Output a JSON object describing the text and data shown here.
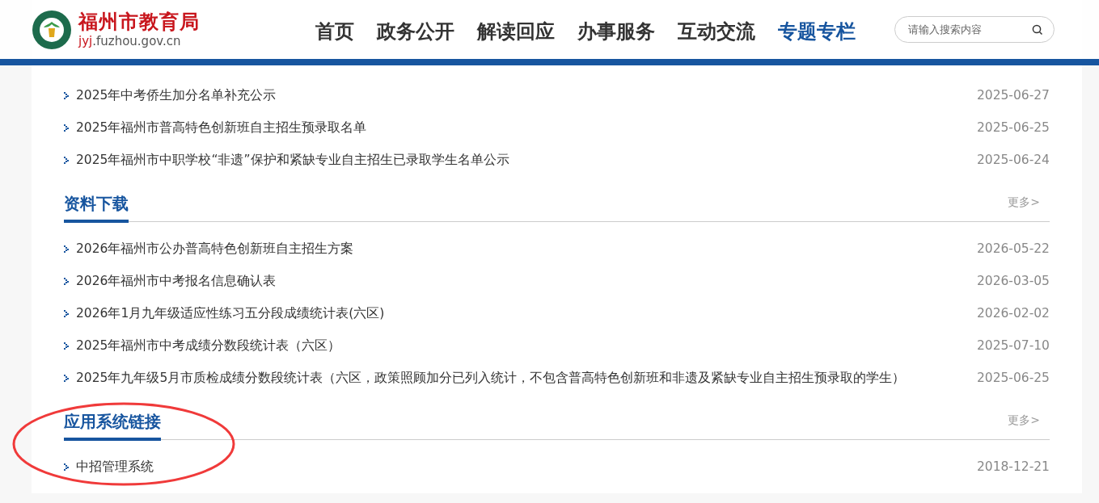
{
  "header": {
    "site_name": "福州市教育局",
    "site_url": {
      "highlight": "jyj",
      "rest": ".fuzhou.gov.cn"
    },
    "nav": [
      {
        "label": "首页",
        "selected": false
      },
      {
        "label": "政务公开",
        "selected": false
      },
      {
        "label": "解读回应",
        "selected": false
      },
      {
        "label": "办事服务",
        "selected": false
      },
      {
        "label": "互动交流",
        "selected": false
      },
      {
        "label": "专题专栏",
        "selected": true
      }
    ],
    "search": {
      "placeholder": "请输入搜索内容"
    }
  },
  "sections": [
    {
      "items": [
        {
          "title": "2025年中考侨生加分名单补充公示",
          "date": "2025-06-27"
        },
        {
          "title": "2025年福州市普高特色创新班自主招生预录取名单",
          "date": "2025-06-25"
        },
        {
          "title": "2025年福州市中职学校“非遗”保护和紧缺专业自主招生已录取学生名单公示",
          "date": "2025-06-24"
        }
      ]
    },
    {
      "title": "资料下载",
      "more": "更多>",
      "items": [
        {
          "title": "2026年福州市公办普高特色创新班自主招生方案",
          "date": "2026-05-22"
        },
        {
          "title": "2026年福州市中考报名信息确认表",
          "date": "2026-03-05"
        },
        {
          "title": "2026年1月九年级适应性练习五分段成绩统计表(六区)",
          "date": "2026-02-02"
        },
        {
          "title": "2025年福州市中考成绩分数段统计表（六区）",
          "date": "2025-07-10"
        },
        {
          "title": "2025年九年级5月市质检成绩分数段统计表（六区，政策照顾加分已列入统计，不包含普高特色创新班和非遗及紧缺专业自主招生预录取的学生）",
          "date": "2025-06-25"
        }
      ]
    },
    {
      "title": "应用系统链接",
      "more": "更多>",
      "items": [
        {
          "title": "中招管理系统",
          "date": "2018-12-21"
        }
      ]
    }
  ]
}
